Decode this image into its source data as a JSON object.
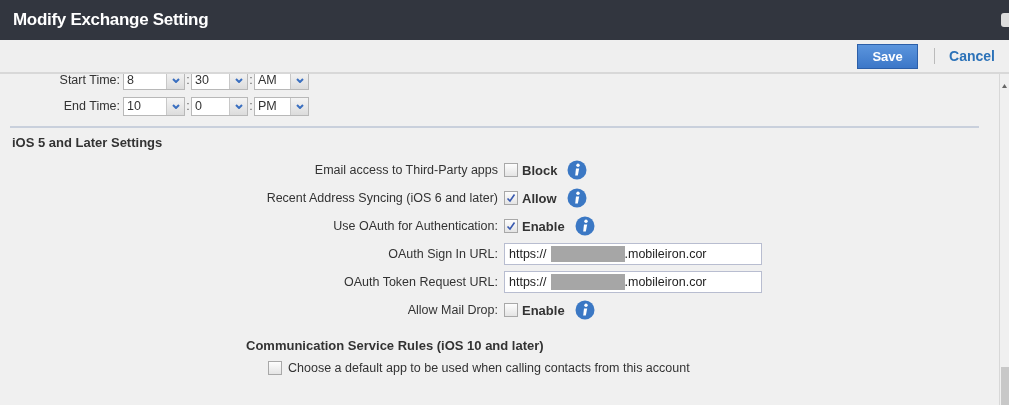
{
  "window": {
    "title": "Modify Exchange Setting"
  },
  "toolbar": {
    "buttons": [
      {
        "label": "Save",
        "kind": "primary"
      },
      {
        "label": "Cancel",
        "kind": "link"
      }
    ]
  },
  "time_rows": [
    {
      "label": "Start Time:",
      "hour": "8",
      "separator_1": ":",
      "minute": "30",
      "separator_2": ":",
      "period": "AM"
    },
    {
      "label": "End Time:",
      "hour": "10",
      "separator_1": ":",
      "minute": "0",
      "separator_2": ":",
      "period": "PM"
    }
  ],
  "ios5_section": {
    "heading": "iOS 5 and Later Settings",
    "rows": [
      {
        "kind": "checkbox",
        "label": "Email access to Third-Party apps",
        "checked": false,
        "option": "Block"
      },
      {
        "kind": "checkbox",
        "label": "Recent Address Syncing (iOS 6 and later)",
        "checked": true,
        "option": "Allow"
      },
      {
        "kind": "checkbox",
        "label": "Use OAuth for Authentication:",
        "checked": true,
        "option": "Enable"
      },
      {
        "kind": "url",
        "label": "OAuth Sign In URL:",
        "value_start": "https://",
        "value_end": ".mobileiron.cor"
      },
      {
        "kind": "url",
        "label": "OAuth Token Request URL:",
        "value_start": "https://",
        "value_end": ".mobileiron.cor"
      },
      {
        "kind": "checkbox",
        "label": "Allow Mail Drop:",
        "checked": false,
        "option": "Enable"
      }
    ]
  },
  "communication_section": {
    "heading": "Communication Service Rules (iOS 10 and later)",
    "options": [
      {
        "label": "Choose a default app to be used when calling contacts from this account",
        "checked": false
      }
    ]
  }
}
